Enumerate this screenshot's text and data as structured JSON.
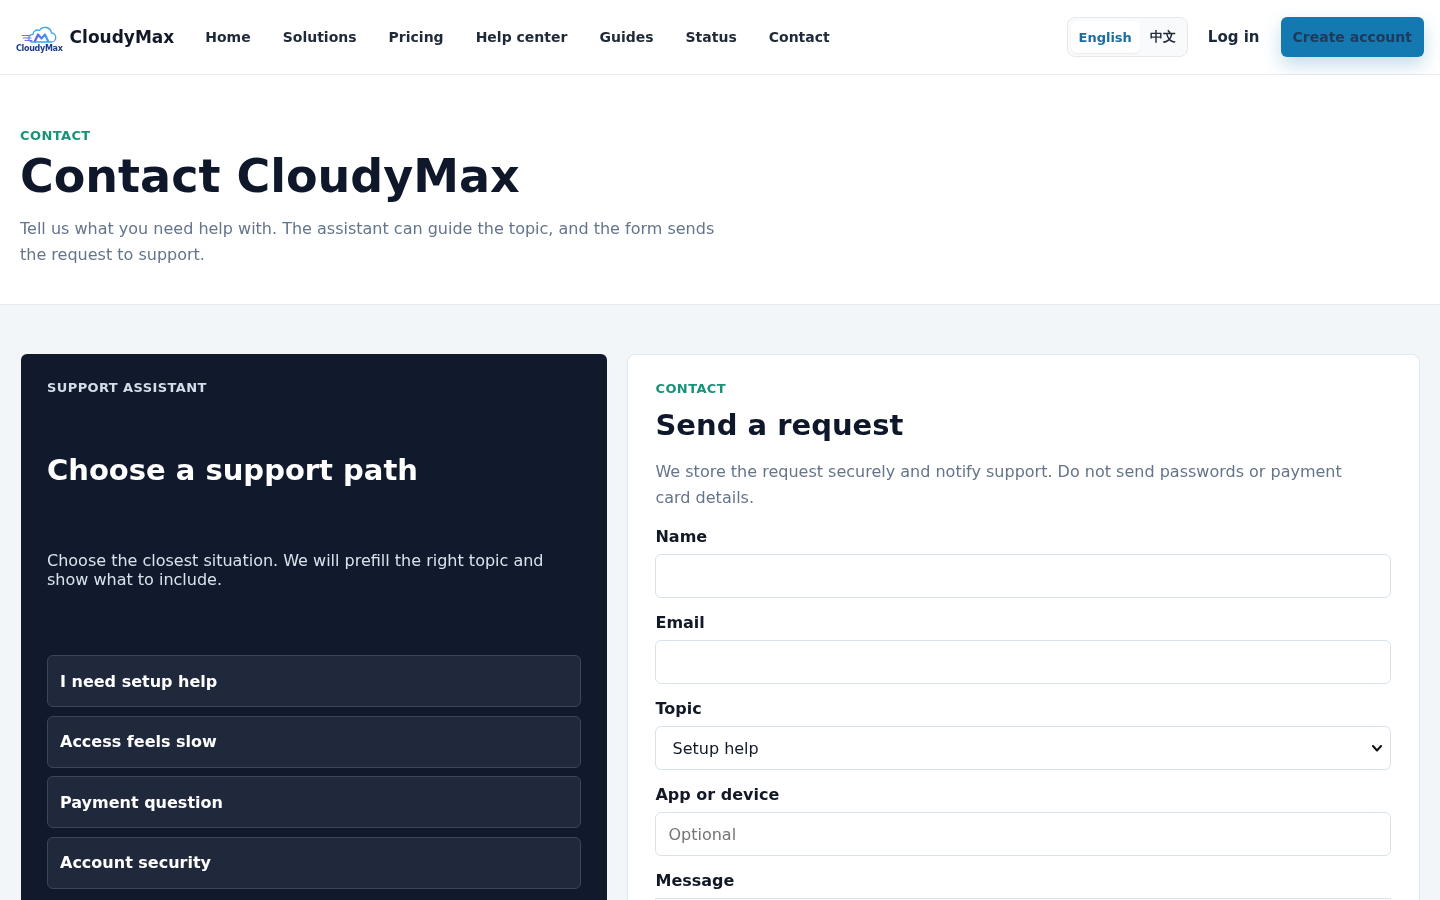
{
  "header": {
    "logo": {
      "caption": "CloudyMax"
    },
    "brand": "CloudyMax",
    "nav": [
      {
        "label": "Home"
      },
      {
        "label": "Solutions"
      },
      {
        "label": "Pricing"
      },
      {
        "label": "Help center"
      },
      {
        "label": "Guides"
      },
      {
        "label": "Status"
      },
      {
        "label": "Contact"
      }
    ],
    "languages": [
      {
        "label": "English",
        "selected": true
      },
      {
        "label": "中文",
        "selected": false
      }
    ],
    "login": "Log in",
    "cta": "Create account"
  },
  "hero": {
    "eyebrow": "CONTACT",
    "title": "Contact CloudyMax",
    "text": "Tell us what you need help with. The assistant can guide the topic, and the form sends the request to support."
  },
  "assistant": {
    "eyebrow": "SUPPORT ASSISTANT",
    "title": "Choose a support path",
    "text": "Choose the closest situation. We will prefill the right topic and show what to include.",
    "options": [
      {
        "label": "I need setup help"
      },
      {
        "label": "Access feels slow"
      },
      {
        "label": "Payment question"
      },
      {
        "label": "Account security"
      }
    ]
  },
  "form": {
    "eyebrow": "CONTACT",
    "title": "Send a request",
    "text": "We store the request securely and notify support. Do not send passwords or payment card details.",
    "fields": [
      {
        "kind": "input",
        "label": "Name"
      },
      {
        "kind": "input",
        "label": "Email"
      },
      {
        "kind": "select",
        "label": "Topic",
        "value": "Setup help"
      },
      {
        "kind": "input",
        "label": "App or device",
        "placeholder": "Optional"
      },
      {
        "kind": "textarea",
        "label": "Message"
      }
    ]
  }
}
